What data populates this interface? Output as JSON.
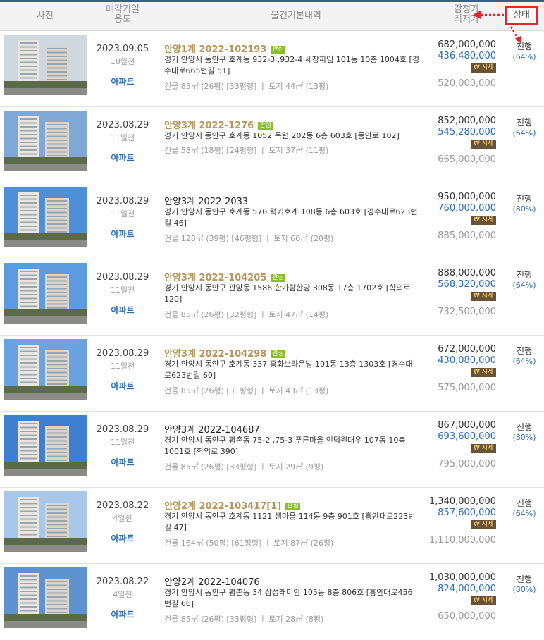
{
  "header": {
    "photo": "사진",
    "date_line1": "매각기일",
    "date_line2": "용도",
    "info": "물건기본내역",
    "price_line1": "감정가",
    "price_line2": "최저가",
    "status": "상태"
  },
  "colors": {
    "accent_red": "#e4252f",
    "link_blue": "#2b6cb3",
    "gold": "#b8955a",
    "tag_green": "#8bbd2a"
  },
  "listings": [
    {
      "date": "2023.09.05",
      "days": "18일전",
      "usage": "아파트",
      "case": "안양1계 2022-102193",
      "tag": "관심",
      "address": "경기 안양시 동안구 호계동 932-3 ,932-4 세창짜임 101동 10층 1004호 [경수대로665번길 51]",
      "area": "건물 85㎡ (26평) [33평형]  ㅣ  토지 44㎡ (13평)",
      "appraisal": "682,000,000",
      "minimum": "436,480,000",
      "market": "시세",
      "last": "520,000,000",
      "status": "진행",
      "pct": "(64%)"
    },
    {
      "date": "2023.08.29",
      "days": "11일전",
      "usage": "아파트",
      "case": "안양3계 2022-1276",
      "tag": "관심",
      "address": "경기 안양시 동안구 호계동 1052 목련 202동 6층 603호 [동안로 102]",
      "area": "건물 58㎡ (18평) [24평형]  ㅣ  토지 37㎡ (11평)",
      "appraisal": "852,000,000",
      "minimum": "545,280,000",
      "market": "시세",
      "last": "665,000,000",
      "status": "진행",
      "pct": "(64%)"
    },
    {
      "date": "2023.08.29",
      "days": "11일전",
      "usage": "아파트",
      "case": "안양3계 2022-2033",
      "tag": "",
      "address": "경기 안양시 동안구 호계동 570 럭키호계 108동 6층 603호 [경수대로623번길 46]",
      "area": "건물 128㎡ (39평) [46평형]  ㅣ  토지 66㎡ (20평)",
      "appraisal": "950,000,000",
      "minimum": "760,000,000",
      "market": "시세",
      "last": "885,000,000",
      "status": "진행",
      "pct": "(80%)"
    },
    {
      "date": "2023.08.29",
      "days": "11일전",
      "usage": "아파트",
      "case": "안양3계 2022-104205",
      "tag": "관심",
      "address": "경기 안양시 동안구 관양동 1586 한가람한양 308동 17층 1702호 [학의로 120]",
      "area": "건물 85㎡ (26평) [32평형]  ㅣ  토지 47㎡ (14평)",
      "appraisal": "888,000,000",
      "minimum": "568,320,000",
      "market": "시세",
      "last": "732,500,000",
      "status": "진행",
      "pct": "(64%)"
    },
    {
      "date": "2023.08.29",
      "days": "11일전",
      "usage": "아파트",
      "case": "안양3계 2022-104298",
      "tag": "관심",
      "address": "경기 안양시 동안구 호계동 337 홍화브라운빌 101동 13층 1303호 [경수대로623번길 60]",
      "area": "건물 85㎡ (26평) [31평형]  ㅣ  토지 43㎡ (13평)",
      "appraisal": "672,000,000",
      "minimum": "430,080,000",
      "market": "시세",
      "last": "575,000,000",
      "status": "진행",
      "pct": "(64%)"
    },
    {
      "date": "2023.08.29",
      "days": "11일전",
      "usage": "아파트",
      "case": "안양3계 2022-104687",
      "tag": "",
      "address": "경기 안양시 동안구 평촌동 75-2 ,75-3 푸른마을 인덕원대우 107동 10층 1001호 [학의로 390]",
      "area": "건물 85㎡ (26평) [33평형]  ㅣ  토지 29㎡ (9평)",
      "appraisal": "867,000,000",
      "minimum": "693,600,000",
      "market": "시세",
      "last": "795,000,000",
      "status": "진행",
      "pct": "(80%)"
    },
    {
      "date": "2023.08.22",
      "days": "4일전",
      "usage": "아파트",
      "case": "안양2계 2022-103417[1]",
      "tag": "관심",
      "address": "경기 안양시 동안구 호계동 1121 샘마을 114동 9층 901호 [흥안대로223번길 47]",
      "area": "건물 164㎡ (50평) [61평형]  ㅣ  토지 87㎡ (26평)",
      "appraisal": "1,340,000,000",
      "minimum": "857,600,000",
      "market": "시세",
      "last": "1,110,000,000",
      "status": "진행",
      "pct": "(64%)"
    },
    {
      "date": "2023.08.22",
      "days": "4일전",
      "usage": "아파트",
      "case": "안양2계 2022-104076",
      "tag": "",
      "address": "경기 안양시 동안구 평촌동 34 삼성래미안 105동 8층 806호 [흥안대로456번길 66]",
      "area": "건물 85㎡ (26평) [33평형]  ㅣ  토지 28㎡ (8평)",
      "appraisal": "1,030,000,000",
      "minimum": "824,000,000",
      "market": "시세",
      "last": "650,000,000",
      "status": "진행",
      "pct": "(80%)"
    }
  ]
}
